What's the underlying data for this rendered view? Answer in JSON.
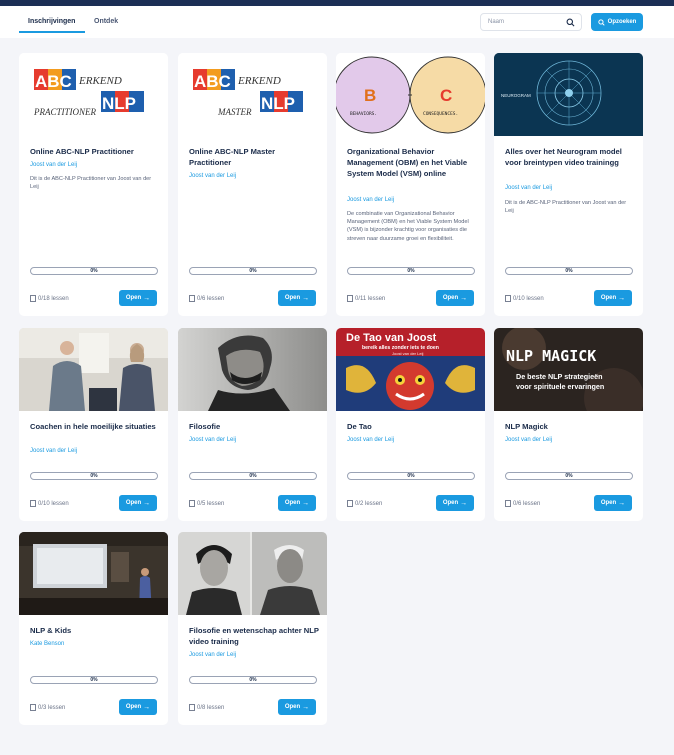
{
  "header": {
    "tabs": [
      {
        "label": "Inschrijvingen",
        "active": true
      },
      {
        "label": "Ontdek",
        "active": false
      }
    ],
    "search": {
      "placeholder": "Naam"
    },
    "search_button_label": "Opzoeken"
  },
  "open_label": "Open",
  "courses": [
    {
      "title": "Online ABC-NLP Practitioner",
      "author": "Joost van der Leij",
      "description": "Dit is de ABC-NLP Practitioner van Joost van der Leij",
      "progress": "0%",
      "progress_value": 0,
      "lessons": "0/18 lessen",
      "thumb": "abc-nlp-practitioner-logo",
      "thumb_text": {
        "top": "ABC",
        "erkend": "ERKEND",
        "nlp": "NLP",
        "sub": "PRACTITIONER"
      }
    },
    {
      "title": "Online ABC-NLP Master Practitioner",
      "author": "Joost van der Leij",
      "description": "",
      "progress": "0%",
      "progress_value": 0,
      "lessons": "0/6 lessen",
      "thumb": "abc-nlp-master-logo",
      "thumb_text": {
        "top": "ABC",
        "erkend": "ERKEND",
        "nlp": "NLP",
        "sub": "MASTER"
      }
    },
    {
      "title": "Organizational Behavior Management (OBM) en het Viable System Model (VSM) online",
      "author": "Joost van der Leij",
      "description": "De combinatie van Organizational Behavior Management (OBM) en het Viable System Model (VSM) is bijzonder krachtig voor organisaties die streven naar duurzame groei en flexibiliteit.",
      "progress": "0%",
      "progress_value": 0,
      "lessons": "0/11 lessen",
      "thumb": "behaviors-consequences-diagram",
      "thumb_text": {
        "b": "B",
        "c": "C",
        "b_label": "BEHAVIORS.",
        "c_label": "CONSEQUENCES."
      }
    },
    {
      "title": "Alles over het Neurogram model voor breintypen video trainingg",
      "author": "Joost van der Leij",
      "description": "Dit is de ABC-NLP Practitioner van Joost van der Leij",
      "progress": "0%",
      "progress_value": 0,
      "lessons": "0/10 lessen",
      "thumb": "neurogram-wheel",
      "thumb_text": {
        "label": "NEUROGRAM"
      }
    },
    {
      "title": "Coachen in hele moeilijke situaties",
      "author": "Joost van der Leij",
      "description": "",
      "progress": "0%",
      "progress_value": 0,
      "lessons": "0/10 lessen",
      "thumb": "coaching-photo"
    },
    {
      "title": "Filosofie",
      "author": "Joost van der Leij",
      "description": "",
      "progress": "0%",
      "progress_value": 0,
      "lessons": "0/5 lessen",
      "thumb": "philosopher-portrait"
    },
    {
      "title": "De Tao",
      "author": "Joost van der Leij",
      "description": "",
      "progress": "0%",
      "progress_value": 0,
      "lessons": "0/2 lessen",
      "thumb": "de-tao-cover",
      "thumb_text": {
        "headline": "De Tao van Joost",
        "sub": "bereik alles zonder iets te doen",
        "author": "Joost van der Leij"
      }
    },
    {
      "title": "NLP Magick",
      "author": "Joost van der Leij",
      "description": "",
      "progress": "0%",
      "progress_value": 0,
      "lessons": "0/6 lessen",
      "thumb": "nlp-magick-cover",
      "thumb_text": {
        "headline": "NLP MAGICK",
        "sub1": "De beste NLP strategieën",
        "sub2": "voor spirituele ervaringen"
      }
    },
    {
      "title": "NLP & Kids",
      "author": "Kate Benson",
      "description": "",
      "progress": "0%",
      "progress_value": 0,
      "lessons": "0/3 lessen",
      "thumb": "classroom-photo"
    },
    {
      "title": "Filosofie en wetenschap achter NLP video training",
      "author": "Joost van der Leij",
      "description": "",
      "progress": "0%",
      "progress_value": 0,
      "lessons": "0/8 lessen",
      "thumb": "two-portraits-photo"
    }
  ],
  "colors": {
    "accent": "#1a9ae0",
    "navy": "#1c2f55",
    "background": "#f4f5f9"
  }
}
